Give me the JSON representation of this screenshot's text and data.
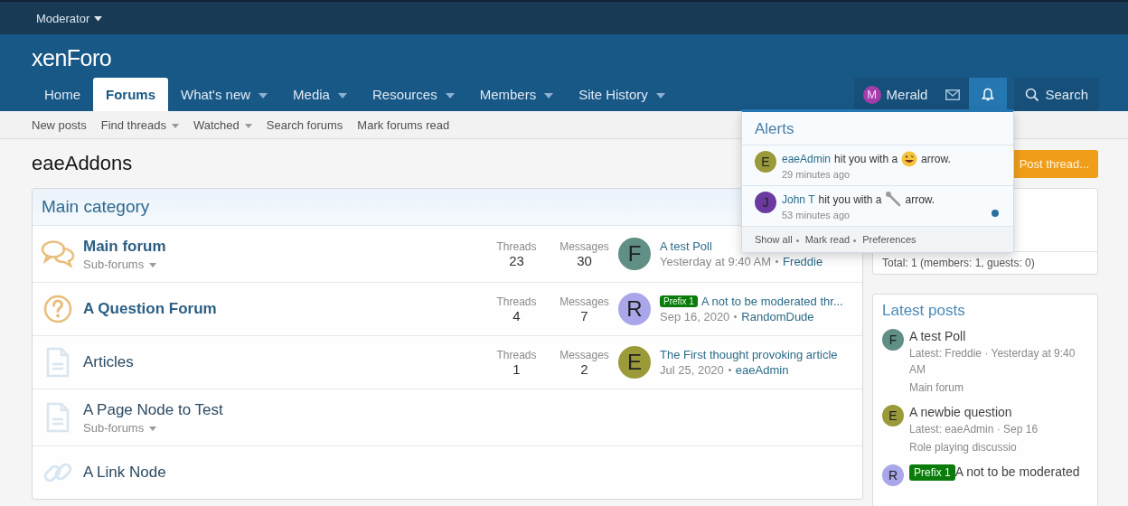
{
  "staff_bar": {
    "label": "Moderator",
    "has_menu": true
  },
  "logo": {
    "text": "xenForo"
  },
  "nav": [
    {
      "label": "Home",
      "selected": false,
      "has_menu": false
    },
    {
      "label": "Forums",
      "selected": true,
      "has_menu": false
    },
    {
      "label": "What's new",
      "selected": false,
      "has_menu": true
    },
    {
      "label": "Media",
      "selected": false,
      "has_menu": true
    },
    {
      "label": "Resources",
      "selected": false,
      "has_menu": true
    },
    {
      "label": "Members",
      "selected": false,
      "has_menu": true
    },
    {
      "label": "Site History",
      "selected": false,
      "has_menu": true
    }
  ],
  "user": {
    "avatar_letter": "M",
    "name": "Merald",
    "alerts_open": true,
    "search_label": "Search"
  },
  "subnav": [
    {
      "label": "New posts",
      "has_menu": false
    },
    {
      "label": "Find threads",
      "has_menu": true
    },
    {
      "label": "Watched",
      "has_menu": true
    },
    {
      "label": "Search forums",
      "has_menu": false
    },
    {
      "label": "Mark forums read",
      "has_menu": false
    }
  ],
  "page_title": "eaeAddons",
  "post_thread_button": "Post thread...",
  "category": {
    "title": "Main category",
    "nodes": [
      {
        "kind": "forum",
        "title": "Main forum",
        "unread": true,
        "sub_forums": "Sub-forums",
        "stats": [
          {
            "label": "Threads",
            "value": "23"
          },
          {
            "label": "Messages",
            "value": "30"
          }
        ],
        "last": {
          "letter": "F",
          "color": "#5f8f85",
          "title": "A test Poll",
          "date": "Yesterday at 9:40 AM",
          "user": "Freddie"
        }
      },
      {
        "kind": "question",
        "title": "A Question Forum",
        "unread": true,
        "stats": [
          {
            "label": "Threads",
            "value": "4"
          },
          {
            "label": "Messages",
            "value": "7"
          }
        ],
        "last": {
          "letter": "R",
          "color": "#aaa6ea",
          "prefix": "Prefix 1",
          "title": "A not to be moderated thr...",
          "date": "Sep 16, 2020",
          "user": "RandomDude"
        }
      },
      {
        "kind": "article",
        "title": "Articles",
        "unread": false,
        "stats": [
          {
            "label": "Threads",
            "value": "1"
          },
          {
            "label": "Messages",
            "value": "2"
          }
        ],
        "last": {
          "letter": "E",
          "color": "#9a9a38",
          "title": "The First thought provoking article",
          "date": "Jul 25, 2020",
          "user": "eaeAdmin"
        }
      },
      {
        "kind": "page",
        "title": "A Page Node to Test",
        "unread": false,
        "sub_forums": "Sub-forums"
      },
      {
        "kind": "link",
        "title": "A Link Node",
        "unread": false
      }
    ]
  },
  "online_box": {
    "total": "Total: 1 (members: 1, guests: 0)"
  },
  "latest_posts": {
    "title": "Latest posts",
    "items": [
      {
        "letter": "F",
        "color": "#5f8f85",
        "title": "A test Poll",
        "meta": "Latest: Freddie · Yesterday at 9:40 AM",
        "forum": "Main forum"
      },
      {
        "letter": "E",
        "color": "#9a9a38",
        "title": "A newbie question",
        "meta": "Latest: eaeAdmin · Sep 16",
        "forum": "Role playing discussio"
      },
      {
        "letter": "R",
        "color": "#aaa6ea",
        "prefix": "Prefix 1",
        "title": "A not to be moderated"
      }
    ]
  },
  "alerts": {
    "title": "Alerts",
    "items": [
      {
        "letter": "E",
        "color": "#9a9a38",
        "user": "eaeAdmin",
        "text": "hit you with a",
        "kind": "grin",
        "suffix": "arrow.",
        "time": "29 minutes ago",
        "unread": false
      },
      {
        "letter": "J",
        "color": "#6b3aa0",
        "user": "John T",
        "text": "hit you with a",
        "kind": "wrench",
        "suffix": "arrow.",
        "time": "53 minutes ago",
        "unread": true
      }
    ],
    "footer": [
      "Show all",
      "Mark read",
      "Preferences"
    ]
  }
}
